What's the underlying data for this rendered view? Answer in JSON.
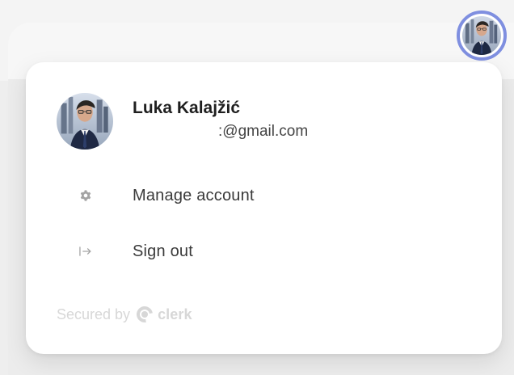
{
  "header": {
    "avatar_label": "user avatar"
  },
  "user_menu": {
    "name": "Luka Kalajžić",
    "email": ":@gmail.com",
    "items": [
      {
        "label": "Manage account",
        "icon": "gear-icon"
      },
      {
        "label": "Sign out",
        "icon": "sign-out-icon"
      }
    ],
    "footer_prefix": "Secured by",
    "footer_brand": "clerk"
  },
  "colors": {
    "accent": "#7f8fe0",
    "text_primary": "#1f1f1f",
    "text_secondary": "#444444",
    "muted": "#d7d7d7",
    "menu_icon": "#a3a3a3"
  }
}
